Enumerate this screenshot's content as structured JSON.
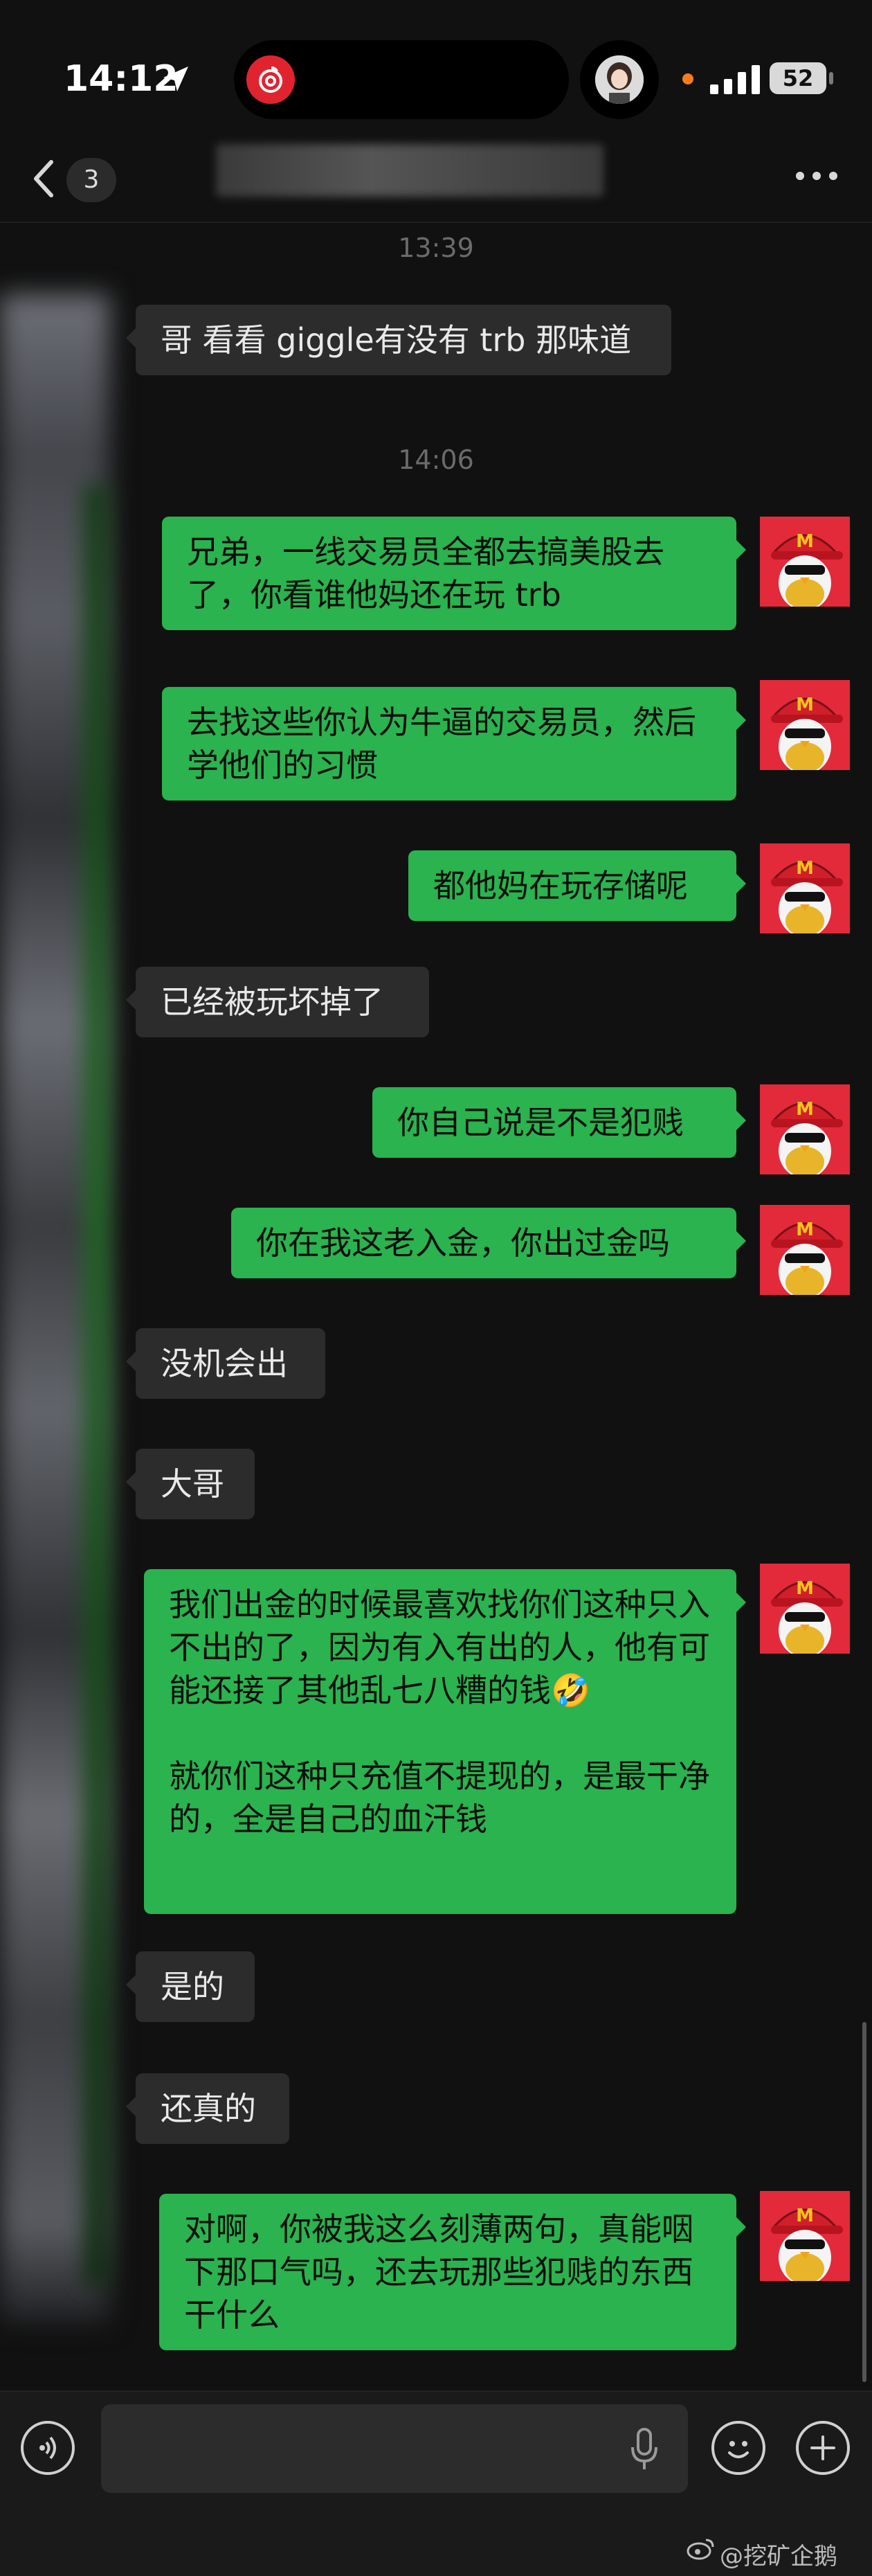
{
  "status_bar": {
    "time": "14:12",
    "battery": "52"
  },
  "header": {
    "back_count": "3"
  },
  "timestamps": [
    "13:39",
    "14:06"
  ],
  "messages": [
    {
      "side": "in",
      "text": "哥 看看 giggle有没有 trb 那味道"
    },
    {
      "side": "out",
      "text": "兄弟，一线交易员全都去搞美股去了，你看谁他妈还在玩 trb"
    },
    {
      "side": "out",
      "text": "去找这些你认为牛逼的交易员，然后学他们的习惯"
    },
    {
      "side": "out",
      "text": "都他妈在玩存储呢"
    },
    {
      "side": "in",
      "text": "已经被玩坏掉了"
    },
    {
      "side": "out",
      "text": "你自己说是不是犯贱"
    },
    {
      "side": "out",
      "text": "你在我这老入金，你出过金吗"
    },
    {
      "side": "in",
      "text": "没机会出"
    },
    {
      "side": "in",
      "text": "大哥"
    },
    {
      "side": "out",
      "text": "我们出金的时候最喜欢找你们这种只入不出的了，因为有入有出的人，他有可能还接了其他乱七八糟的钱🤣",
      "text2": "就你们这种只充值不提现的，是最干净的，全是自己的血汗钱"
    },
    {
      "side": "in",
      "text": "是的"
    },
    {
      "side": "in",
      "text": "还真的"
    },
    {
      "side": "out",
      "text": "对啊，你被我这么刻薄两句，真能咽下那口气吗，还去玩那些犯贱的东西干什么"
    }
  ],
  "watermark": "@挖矿企鹅",
  "colors": {
    "outgoing_bubble": "#2ab34e",
    "incoming_bubble": "#2c2c2c",
    "background": "#111111",
    "avatar_bg": "#e22a3a"
  },
  "icons": [
    "location-arrow-icon",
    "netease-music-icon",
    "signal-icon",
    "battery-icon",
    "back-chevron-icon",
    "more-icon",
    "voice-icon",
    "mic-icon",
    "emoji-icon",
    "plus-icon",
    "weibo-icon"
  ]
}
